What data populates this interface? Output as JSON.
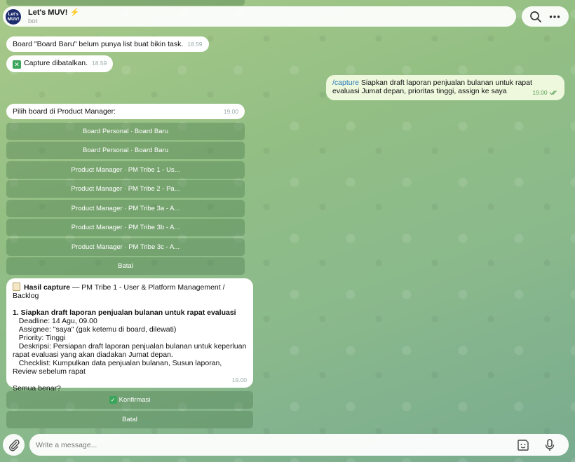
{
  "header": {
    "avatar_text": "Let's MUV!",
    "title": "Let's MUV! ⚡",
    "subtitle": "bot",
    "search_icon": "search-icon",
    "more_icon": "more-dots-icon"
  },
  "messages": {
    "board_no_list": {
      "text": "Board \"Board Baru\" belum punya list buat bikin task.",
      "time": "18.59"
    },
    "capture_cancelled": {
      "emoji": "✕",
      "text": "Capture dibatalkan.",
      "time": "18.59"
    },
    "user_capture": {
      "command": "/capture",
      "text": " Siapkan draft laporan penjualan bulanan untuk rapat evaluasi Jumat depan, prioritas tinggi, assign ke saya",
      "time": "19.00",
      "status_icon": "double-check-icon"
    },
    "choose_board": {
      "text": "Pilih board di Product Manager:",
      "time": "19.00"
    },
    "board_buttons": [
      "Board Personal · Board Baru",
      "Board Personal · Board Baru",
      "Product Manager · PM Tribe 1 - Us...",
      "Product Manager · PM Tribe 2 - Pa...",
      "Product Manager · PM Tribe 3a - A...",
      "Product Manager · PM Tribe 3b - A...",
      "Product Manager · PM Tribe 3c - A...",
      "Batal"
    ],
    "capture_result": {
      "title": "Hasil capture",
      "context": " — PM Tribe 1 - User & Platform Management / Backlog",
      "item_title": "1. Siapkan draft laporan penjualan bulanan untuk rapat evaluasi",
      "details": "   Deadline: 14 Agu, 09.00\n   Assignee: \"saya\" (gak ketemu di board, dilewati)\n   Priority: Tinggi\n   Deskripsi: Persiapan draft laporan penjualan bulanan untuk keperluan rapat evaluasi yang akan diadakan Jumat depan.\n   Checklist: Kumpulkan data penjualan bulanan, Susun laporan, Review sebelum rapat",
      "question": "Semua benar?",
      "time": "19.00"
    },
    "confirm_buttons": {
      "confirm": "Konfirmasi",
      "cancel": "Batal"
    }
  },
  "composer": {
    "placeholder": "Write a message...",
    "attach_icon": "paperclip-icon",
    "emoji_icon": "sticker-icon",
    "mic_icon": "microphone-icon"
  }
}
